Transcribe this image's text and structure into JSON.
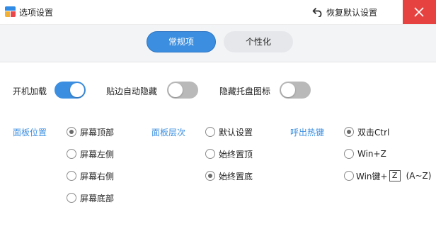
{
  "window": {
    "title": "选项设置",
    "restore_label": "恢复默认设置",
    "colors": {
      "accent": "#3c8fe0",
      "close": "#e64340"
    }
  },
  "tabs": [
    {
      "label": "常规项",
      "active": true
    },
    {
      "label": "个性化",
      "active": false
    }
  ],
  "toggles": [
    {
      "label": "开机加载",
      "on": true
    },
    {
      "label": "贴边自动隐藏",
      "on": false
    },
    {
      "label": "隐藏托盘图标",
      "on": false
    }
  ],
  "groups": {
    "panel_position": {
      "title": "面板位置",
      "options": [
        {
          "label": "屏幕顶部",
          "checked": true
        },
        {
          "label": "屏幕左侧",
          "checked": false
        },
        {
          "label": "屏幕右侧",
          "checked": false
        },
        {
          "label": "屏幕底部",
          "checked": false
        }
      ]
    },
    "panel_layer": {
      "title": "面板层次",
      "options": [
        {
          "label": "默认设置",
          "checked": false
        },
        {
          "label": "始终置顶",
          "checked": false
        },
        {
          "label": "始终置底",
          "checked": true
        }
      ]
    },
    "hotkey": {
      "title": "呼出热键",
      "options": [
        {
          "label": "双击Ctrl",
          "checked": true
        },
        {
          "label": "Win+Z",
          "checked": false
        },
        {
          "label": "Win键+",
          "checked": false,
          "key": "Z",
          "range": "(A~Z)"
        }
      ]
    }
  }
}
